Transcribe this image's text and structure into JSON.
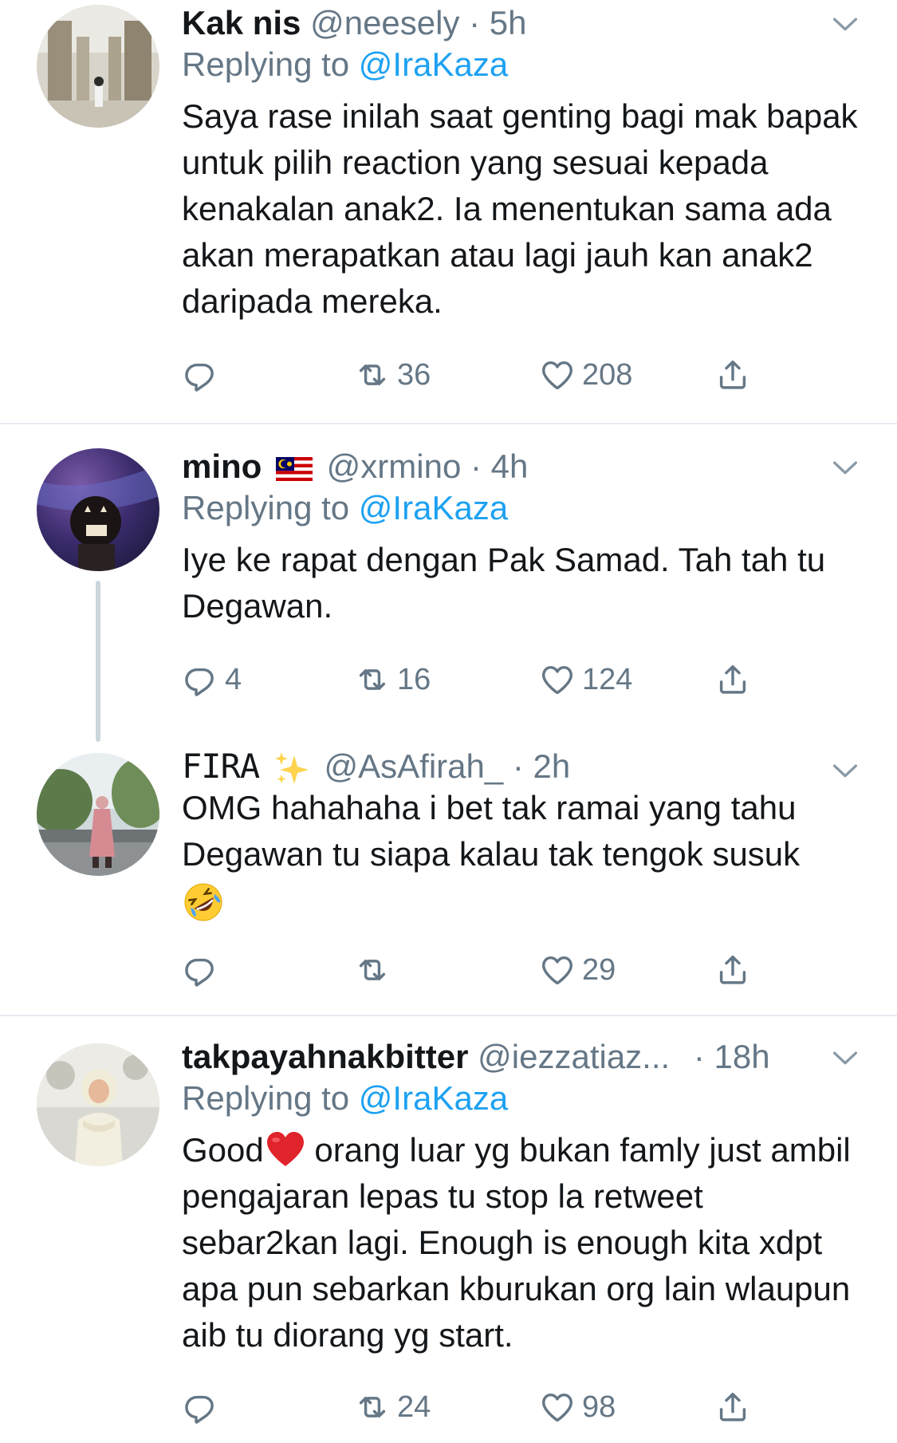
{
  "tweets": [
    {
      "name": "Kak nis",
      "handle": "@neesely",
      "time": "· 5h",
      "replying_prefix": "Replying to ",
      "replying_to": "@IraKaza",
      "text": "Saya rase inilah saat genting bagi mak bapak untuk pilih reaction yang sesuai kepada kenakalan anak2. Ia menentukan sama ada akan merapatkan atau lagi jauh kan anak2 daripada mereka.",
      "replies": "",
      "retweets": "36",
      "likes": "208"
    },
    {
      "name": "mino",
      "flag": "malaysia-flag-icon",
      "handle": "@xrmino",
      "time": "· 4h",
      "replying_prefix": "Replying to ",
      "replying_to": "@IraKaza",
      "text": "Iye ke rapat dengan Pak Samad. Tah tah tu Degawan.",
      "replies": "4",
      "retweets": "16",
      "likes": "124"
    },
    {
      "name": "FIRA",
      "sparkles": "sparkles-icon",
      "handle": "@AsAfirah_",
      "time": "· 2h",
      "text": "OMG hahahaha i bet tak ramai yang tahu Degawan tu siapa kalau tak tengok susuk",
      "emoji": "rolling-laughing-emoji",
      "replies": "",
      "retweets": "",
      "likes": "29"
    },
    {
      "name": "takpayahnakbitter",
      "handle": "@iezzatiaz...",
      "time": "· 18h",
      "replying_prefix": "Replying to ",
      "replying_to": "@IraKaza",
      "text_before_emoji": "Good",
      "emoji": "red-heart-emoji",
      "text": " orang luar yg bukan famly just ambil pengajaran lepas tu stop la retweet sebar2kan lagi. Enough is enough kita xdpt apa pun sebarkan kburukan org lain wlaupun aib tu diorang yg start.",
      "replies": "",
      "retweets": "24",
      "likes": "98"
    }
  ],
  "colors": {
    "text": "#14171a",
    "secondary": "#657786",
    "link": "#1da1f2",
    "divider": "#e6ecf0",
    "thread_line": "#ccd6dd"
  }
}
